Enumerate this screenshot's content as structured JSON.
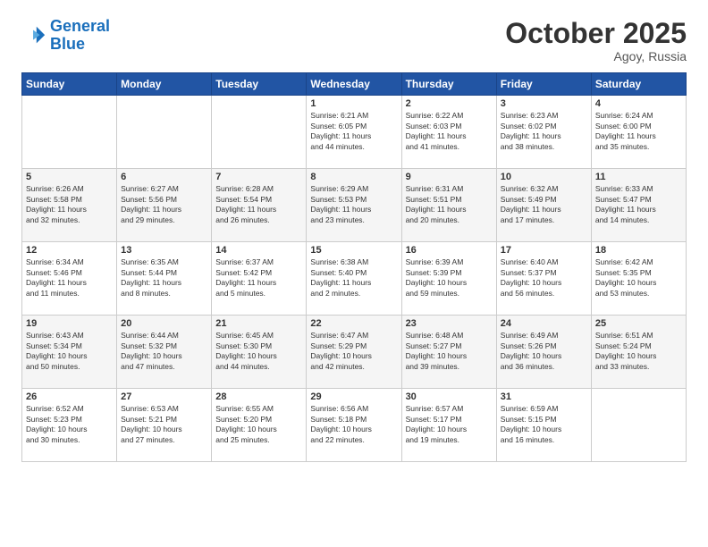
{
  "logo": {
    "line1": "General",
    "line2": "Blue"
  },
  "header": {
    "month": "October 2025",
    "location": "Agoy, Russia"
  },
  "weekdays": [
    "Sunday",
    "Monday",
    "Tuesday",
    "Wednesday",
    "Thursday",
    "Friday",
    "Saturday"
  ],
  "weeks": [
    [
      {
        "day": "",
        "info": ""
      },
      {
        "day": "",
        "info": ""
      },
      {
        "day": "",
        "info": ""
      },
      {
        "day": "1",
        "info": "Sunrise: 6:21 AM\nSunset: 6:05 PM\nDaylight: 11 hours\nand 44 minutes."
      },
      {
        "day": "2",
        "info": "Sunrise: 6:22 AM\nSunset: 6:03 PM\nDaylight: 11 hours\nand 41 minutes."
      },
      {
        "day": "3",
        "info": "Sunrise: 6:23 AM\nSunset: 6:02 PM\nDaylight: 11 hours\nand 38 minutes."
      },
      {
        "day": "4",
        "info": "Sunrise: 6:24 AM\nSunset: 6:00 PM\nDaylight: 11 hours\nand 35 minutes."
      }
    ],
    [
      {
        "day": "5",
        "info": "Sunrise: 6:26 AM\nSunset: 5:58 PM\nDaylight: 11 hours\nand 32 minutes."
      },
      {
        "day": "6",
        "info": "Sunrise: 6:27 AM\nSunset: 5:56 PM\nDaylight: 11 hours\nand 29 minutes."
      },
      {
        "day": "7",
        "info": "Sunrise: 6:28 AM\nSunset: 5:54 PM\nDaylight: 11 hours\nand 26 minutes."
      },
      {
        "day": "8",
        "info": "Sunrise: 6:29 AM\nSunset: 5:53 PM\nDaylight: 11 hours\nand 23 minutes."
      },
      {
        "day": "9",
        "info": "Sunrise: 6:31 AM\nSunset: 5:51 PM\nDaylight: 11 hours\nand 20 minutes."
      },
      {
        "day": "10",
        "info": "Sunrise: 6:32 AM\nSunset: 5:49 PM\nDaylight: 11 hours\nand 17 minutes."
      },
      {
        "day": "11",
        "info": "Sunrise: 6:33 AM\nSunset: 5:47 PM\nDaylight: 11 hours\nand 14 minutes."
      }
    ],
    [
      {
        "day": "12",
        "info": "Sunrise: 6:34 AM\nSunset: 5:46 PM\nDaylight: 11 hours\nand 11 minutes."
      },
      {
        "day": "13",
        "info": "Sunrise: 6:35 AM\nSunset: 5:44 PM\nDaylight: 11 hours\nand 8 minutes."
      },
      {
        "day": "14",
        "info": "Sunrise: 6:37 AM\nSunset: 5:42 PM\nDaylight: 11 hours\nand 5 minutes."
      },
      {
        "day": "15",
        "info": "Sunrise: 6:38 AM\nSunset: 5:40 PM\nDaylight: 11 hours\nand 2 minutes."
      },
      {
        "day": "16",
        "info": "Sunrise: 6:39 AM\nSunset: 5:39 PM\nDaylight: 10 hours\nand 59 minutes."
      },
      {
        "day": "17",
        "info": "Sunrise: 6:40 AM\nSunset: 5:37 PM\nDaylight: 10 hours\nand 56 minutes."
      },
      {
        "day": "18",
        "info": "Sunrise: 6:42 AM\nSunset: 5:35 PM\nDaylight: 10 hours\nand 53 minutes."
      }
    ],
    [
      {
        "day": "19",
        "info": "Sunrise: 6:43 AM\nSunset: 5:34 PM\nDaylight: 10 hours\nand 50 minutes."
      },
      {
        "day": "20",
        "info": "Sunrise: 6:44 AM\nSunset: 5:32 PM\nDaylight: 10 hours\nand 47 minutes."
      },
      {
        "day": "21",
        "info": "Sunrise: 6:45 AM\nSunset: 5:30 PM\nDaylight: 10 hours\nand 44 minutes."
      },
      {
        "day": "22",
        "info": "Sunrise: 6:47 AM\nSunset: 5:29 PM\nDaylight: 10 hours\nand 42 minutes."
      },
      {
        "day": "23",
        "info": "Sunrise: 6:48 AM\nSunset: 5:27 PM\nDaylight: 10 hours\nand 39 minutes."
      },
      {
        "day": "24",
        "info": "Sunrise: 6:49 AM\nSunset: 5:26 PM\nDaylight: 10 hours\nand 36 minutes."
      },
      {
        "day": "25",
        "info": "Sunrise: 6:51 AM\nSunset: 5:24 PM\nDaylight: 10 hours\nand 33 minutes."
      }
    ],
    [
      {
        "day": "26",
        "info": "Sunrise: 6:52 AM\nSunset: 5:23 PM\nDaylight: 10 hours\nand 30 minutes."
      },
      {
        "day": "27",
        "info": "Sunrise: 6:53 AM\nSunset: 5:21 PM\nDaylight: 10 hours\nand 27 minutes."
      },
      {
        "day": "28",
        "info": "Sunrise: 6:55 AM\nSunset: 5:20 PM\nDaylight: 10 hours\nand 25 minutes."
      },
      {
        "day": "29",
        "info": "Sunrise: 6:56 AM\nSunset: 5:18 PM\nDaylight: 10 hours\nand 22 minutes."
      },
      {
        "day": "30",
        "info": "Sunrise: 6:57 AM\nSunset: 5:17 PM\nDaylight: 10 hours\nand 19 minutes."
      },
      {
        "day": "31",
        "info": "Sunrise: 6:59 AM\nSunset: 5:15 PM\nDaylight: 10 hours\nand 16 minutes."
      },
      {
        "day": "",
        "info": ""
      }
    ]
  ]
}
